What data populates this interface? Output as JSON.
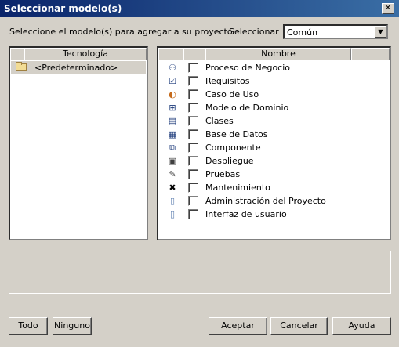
{
  "window": {
    "title": "Seleccionar modelo(s)",
    "close_glyph": "✕"
  },
  "prompt": "Seleccione el modelo(s) para agregar a su proyecto",
  "selector": {
    "label": "Seleccionar",
    "value": "Común",
    "arrow_glyph": "▼"
  },
  "tech_panel": {
    "header": "Tecnología",
    "items": [
      {
        "label": "<Predeterminado>",
        "icon": "folder-icon",
        "selected": true
      }
    ]
  },
  "models_panel": {
    "header": "Nombre",
    "items": [
      {
        "label": "Proceso de Negocio",
        "icon": "business-process-icon",
        "glyph": "⚇",
        "checked": false
      },
      {
        "label": "Requisitos",
        "icon": "requirements-icon",
        "glyph": "☑",
        "checked": false
      },
      {
        "label": "Caso de Uso",
        "icon": "use-case-icon",
        "glyph": "◐",
        "checked": false
      },
      {
        "label": "Modelo de Dominio",
        "icon": "domain-model-icon",
        "glyph": "⊞",
        "checked": false
      },
      {
        "label": "Clases",
        "icon": "classes-icon",
        "glyph": "▤",
        "checked": false
      },
      {
        "label": "Base de Datos",
        "icon": "database-icon",
        "glyph": "▦",
        "checked": false
      },
      {
        "label": "Componente",
        "icon": "component-icon",
        "glyph": "⧉",
        "checked": false
      },
      {
        "label": "Despliegue",
        "icon": "deployment-icon",
        "glyph": "▣",
        "checked": false
      },
      {
        "label": "Pruebas",
        "icon": "testing-icon",
        "glyph": "✎",
        "checked": false
      },
      {
        "label": "Mantenimiento",
        "icon": "maintenance-icon",
        "glyph": "✖",
        "checked": false
      },
      {
        "label": "Administración del Proyecto",
        "icon": "document-icon",
        "glyph": "▯",
        "checked": false
      },
      {
        "label": "Interfaz de usuario",
        "icon": "document-icon",
        "glyph": "▯",
        "checked": false
      }
    ]
  },
  "buttons": {
    "all": "Todo",
    "none": "Ninguno",
    "ok": "Aceptar",
    "cancel": "Cancelar",
    "help": "Ayuda"
  }
}
